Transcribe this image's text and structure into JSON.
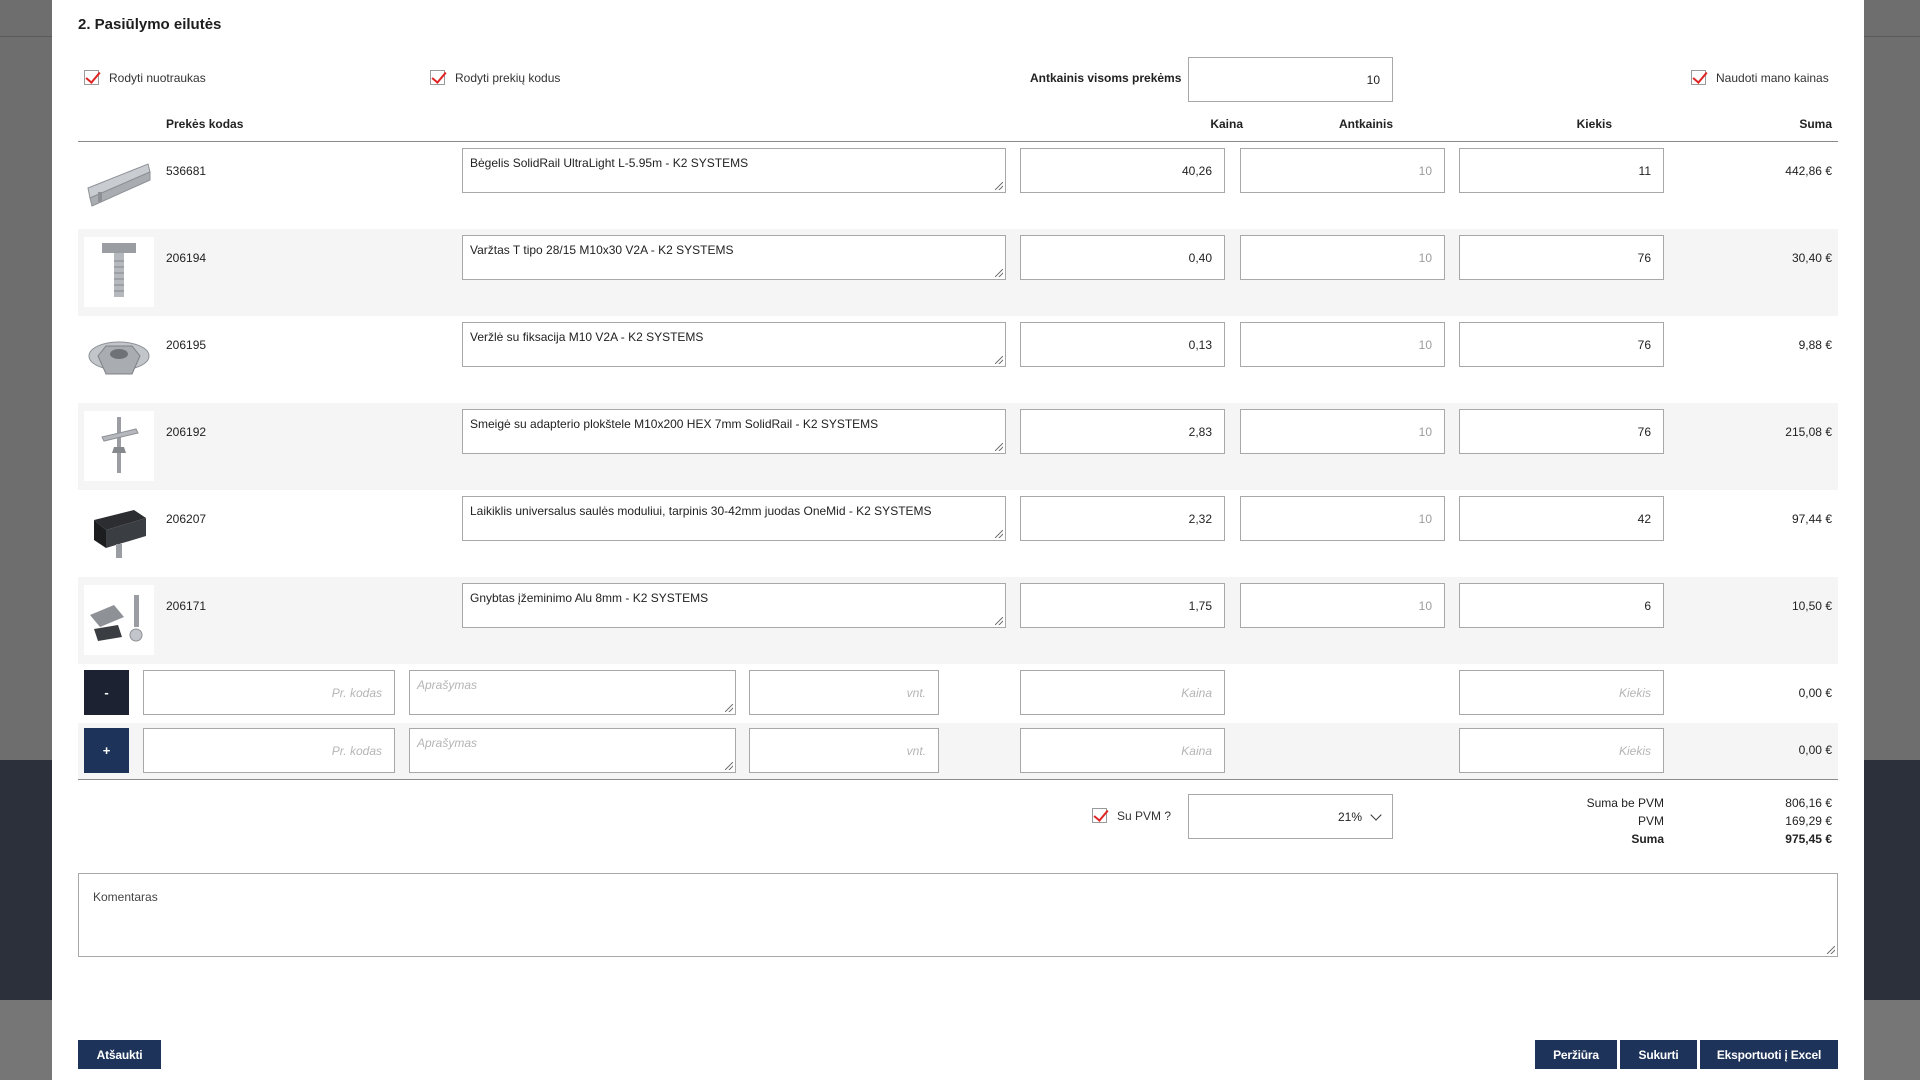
{
  "section_title": "2. Pasiūlymo eilutės",
  "options": {
    "show_photos_label": "Rodyti nuotraukas",
    "show_codes_label": "Rodyti prekių kodus",
    "markup_all_label": "Antkainis visoms prekėms",
    "markup_all_value": "10",
    "use_my_prices_label": "Naudoti mano kainas"
  },
  "columns": {
    "code": "Prekės kodas",
    "price": "Kaina",
    "markup": "Antkainis",
    "qty": "Kiekis",
    "sum": "Suma"
  },
  "rows": [
    {
      "code": "536681",
      "description": "Bėgelis SolidRail UltraLight L-5.95m - K2 SYSTEMS",
      "price": "40,26",
      "markup": "10",
      "qty": "11",
      "sum": "442,86 €",
      "icon": "rail-icon"
    },
    {
      "code": "206194",
      "description": "Varžtas T tipo 28/15 M10x30 V2A - K2 SYSTEMS",
      "price": "0,40",
      "markup": "10",
      "qty": "76",
      "sum": "30,40 €",
      "icon": "bolt-icon"
    },
    {
      "code": "206195",
      "description": "Veržlė su fiksacija M10 V2A - K2 SYSTEMS",
      "price": "0,13",
      "markup": "10",
      "qty": "76",
      "sum": "9,88 €",
      "icon": "nut-icon"
    },
    {
      "code": "206192",
      "description": "Smeigė su adapterio plokštele M10x200 HEX 7mm SolidRail - K2 SYSTEMS",
      "price": "2,83",
      "markup": "10",
      "qty": "76",
      "sum": "215,08 €",
      "icon": "stud-icon"
    },
    {
      "code": "206207",
      "description": "Laikiklis universalus saulės moduliui, tarpinis 30-42mm juodas OneMid - K2 SYSTEMS",
      "price": "2,32",
      "markup": "10",
      "qty": "42",
      "sum": "97,44 €",
      "icon": "clamp-icon"
    },
    {
      "code": "206171",
      "description": "Gnybtas įžeminimo Alu 8mm - K2 SYSTEMS",
      "price": "1,75",
      "markup": "10",
      "qty": "6",
      "sum": "10,50 €",
      "icon": "grounding-clip-icon"
    }
  ],
  "custom_rows": [
    {
      "button": "-",
      "code_placeholder": "Pr. kodas",
      "desc_placeholder": "Aprašymas",
      "unit_placeholder": "vnt.",
      "price_placeholder": "Kaina",
      "qty_placeholder": "Kiekis",
      "sum": "0,00 €"
    },
    {
      "button": "+",
      "code_placeholder": "Pr. kodas",
      "desc_placeholder": "Aprašymas",
      "unit_placeholder": "vnt.",
      "price_placeholder": "Kaina",
      "qty_placeholder": "Kiekis",
      "sum": "0,00 €"
    }
  ],
  "vat": {
    "label": "Su PVM ?",
    "selected": "21%"
  },
  "totals": {
    "without_vat_label": "Suma be PVM",
    "without_vat": "806,16 €",
    "vat_label": "PVM",
    "vat": "169,29 €",
    "total_label": "Suma",
    "total": "975,45 €"
  },
  "comment_placeholder": "Komentaras",
  "buttons": {
    "cancel": "Atšaukti",
    "preview": "Peržiūra",
    "create": "Sukurti",
    "export": "Eksportuoti į Excel"
  },
  "colors": {
    "primary": "#1d3359",
    "check_red": "#e02424",
    "overlay_dark": "#2b303a"
  }
}
